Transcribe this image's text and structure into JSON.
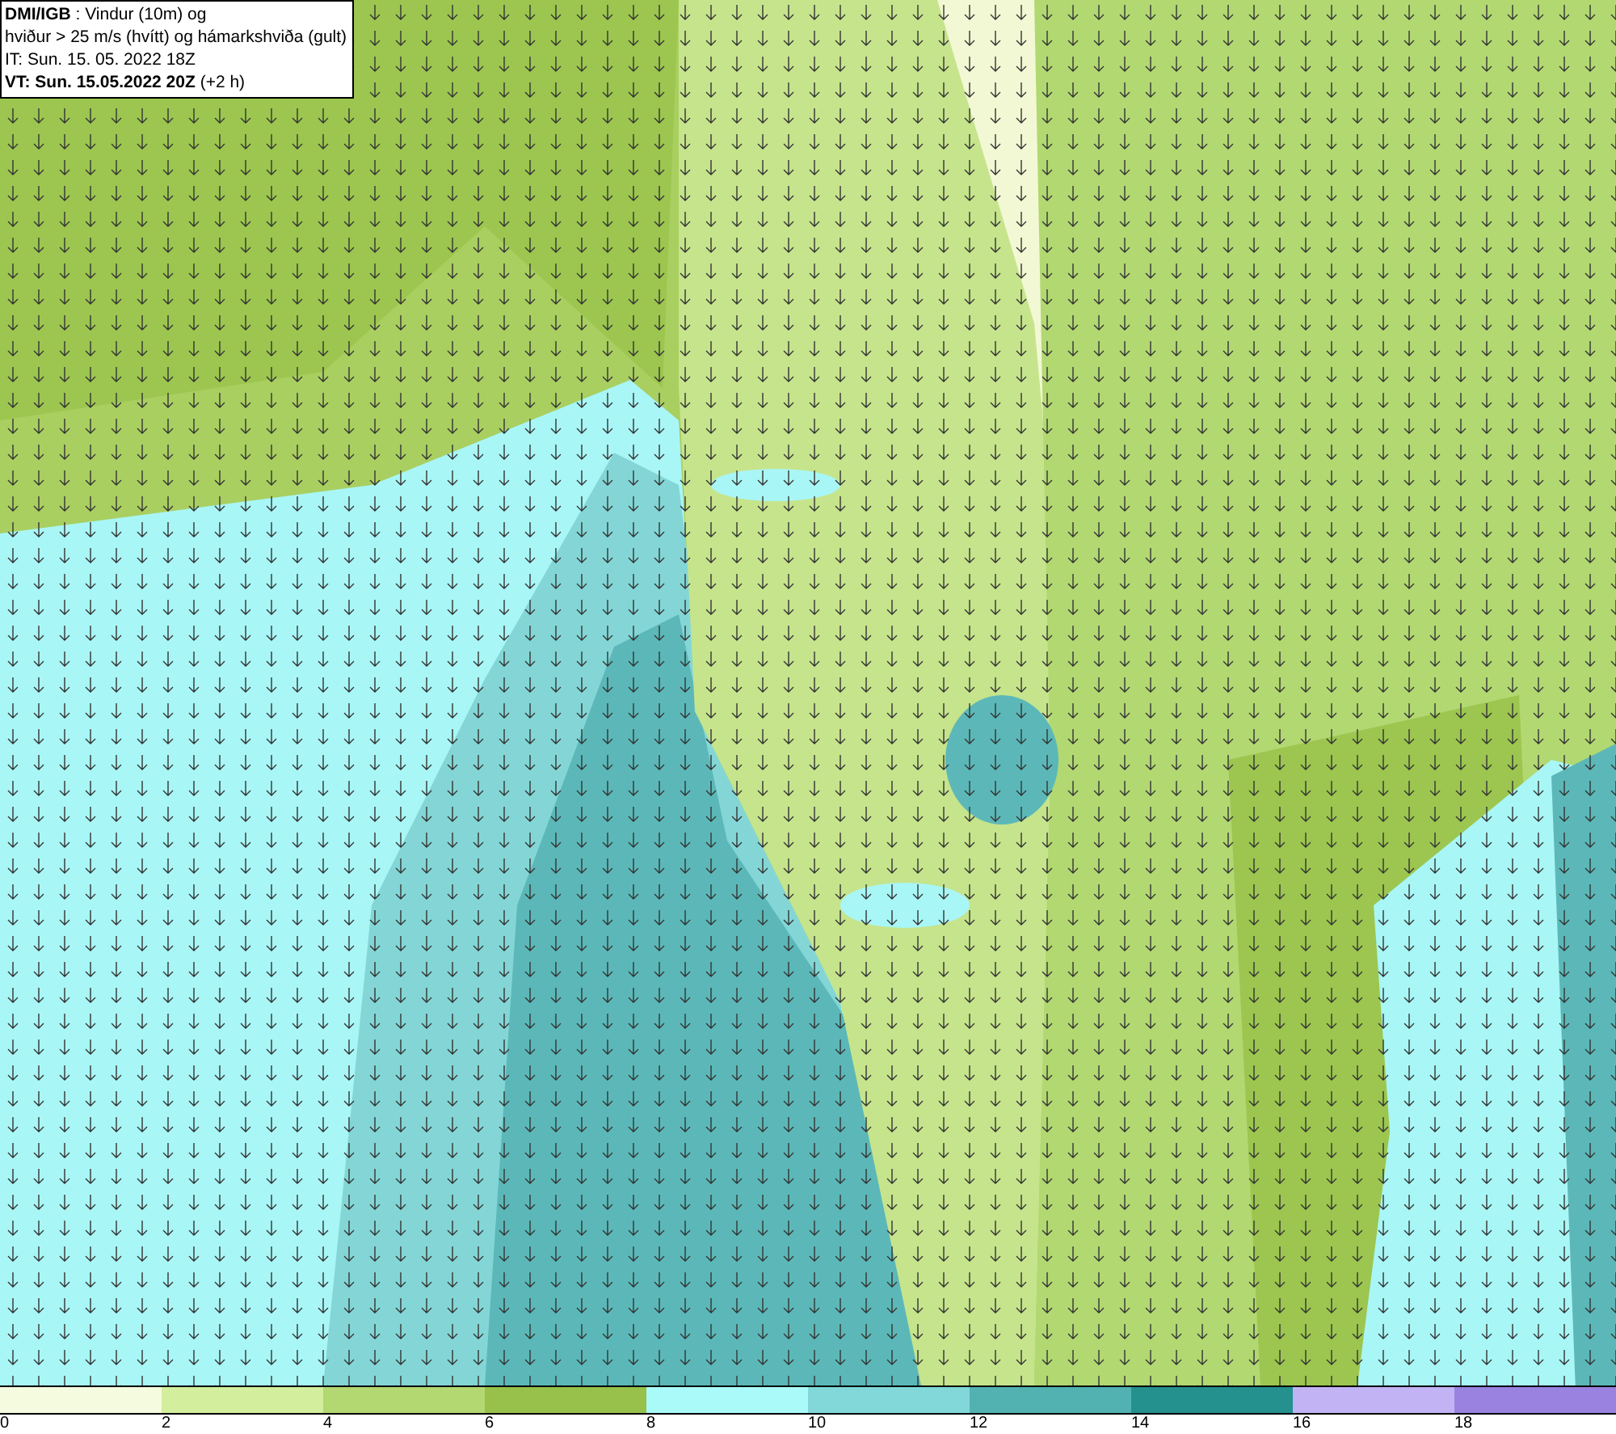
{
  "title_box": {
    "lines": [
      "**DMI/IGB** : Vindur (10m) og",
      "hviður > 25 m/s (hvítt) og hámarkshviða (gult)",
      "IT: Sun. 15. 05. 2022 18Z",
      "**VT: Sun. 15.05.2022 20Z** (+2 h)"
    ]
  },
  "legend": [
    {
      "label": "0",
      "color": "#f5fbdf"
    },
    {
      "label": "2",
      "color": "#d3ee9c"
    },
    {
      "label": "4",
      "color": "#b3d872"
    },
    {
      "label": "6",
      "color": "#97c14a"
    },
    {
      "label": "8",
      "color": "#abfafa"
    },
    {
      "label": "10",
      "color": "#82d8d8"
    },
    {
      "label": "12",
      "color": "#52b2b2"
    },
    {
      "label": "14",
      "color": "#24918f"
    },
    {
      "label": "16",
      "color": "#c2b4f4"
    },
    {
      "label": "18",
      "color": "#9a82e0"
    }
  ]
}
